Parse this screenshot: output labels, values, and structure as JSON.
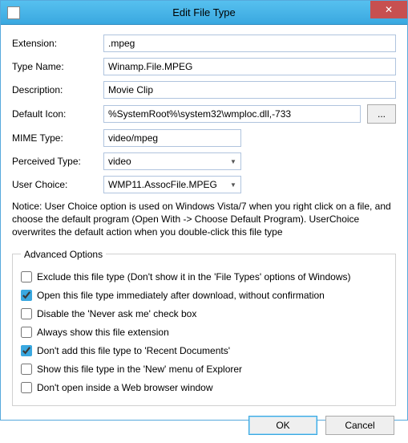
{
  "window": {
    "title": "Edit File Type"
  },
  "form": {
    "extension": {
      "label": "Extension:",
      "value": ".mpeg"
    },
    "typename": {
      "label": "Type Name:",
      "value": "Winamp.File.MPEG"
    },
    "description": {
      "label": "Description:",
      "value": "Movie Clip"
    },
    "defaulticon": {
      "label": "Default Icon:",
      "value": "%SystemRoot%\\system32\\wmploc.dll,-733",
      "browse": "..."
    },
    "mimetype": {
      "label": "MIME Type:",
      "value": "video/mpeg"
    },
    "perceived": {
      "label": "Perceived Type:",
      "value": "video"
    },
    "userchoice": {
      "label": "User Choice:",
      "value": "WMP11.AssocFile.MPEG"
    }
  },
  "notice": "Notice: User Choice option is used on Windows Vista/7 when you right click on a file, and choose the default program (Open With -> Choose Default Program). UserChoice overwrites the default action when you double-click this file type",
  "advanced": {
    "legend": "Advanced Options",
    "opts": [
      {
        "label": "Exclude  this file type (Don't show it in the 'File Types' options of Windows)",
        "checked": false
      },
      {
        "label": "Open this file type immediately after download, without confirmation",
        "checked": true
      },
      {
        "label": "Disable the 'Never ask me' check box",
        "checked": false
      },
      {
        "label": "Always show this file extension",
        "checked": false
      },
      {
        "label": "Don't add this file type to 'Recent Documents'",
        "checked": true
      },
      {
        "label": "Show this file type in the 'New' menu of Explorer",
        "checked": false
      },
      {
        "label": "Don't open inside a Web browser window",
        "checked": false
      }
    ]
  },
  "buttons": {
    "ok": "OK",
    "cancel": "Cancel"
  }
}
